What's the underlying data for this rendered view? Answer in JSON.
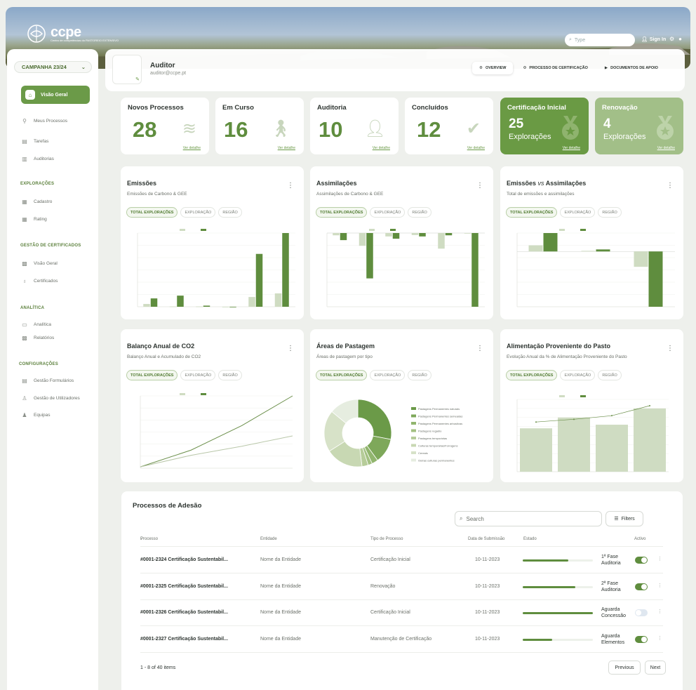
{
  "brand": {
    "name": "ccpe",
    "subtitle": "Centro de competências do PASTOREIO EXTENSIVO"
  },
  "topbar": {
    "search_placeholder": "Type",
    "signin": "Sign In"
  },
  "sidebar": {
    "campaign": "CAMPANHA 23/24",
    "active": "Visão Geral",
    "items_top": [
      "Meus Processos",
      "Tarefas",
      "Auditorias"
    ],
    "sections": [
      {
        "title": "EXPLORAÇÕES",
        "items": [
          "Cadastro",
          "Rating"
        ]
      },
      {
        "title": "GESTÃO DE CERTIFICADOS",
        "items": [
          "Visão Geral",
          "Certificados"
        ]
      },
      {
        "title": "ANALÍTICA",
        "items": [
          "Analítica",
          "Relatórios"
        ]
      },
      {
        "title": "CONFIGURAÇÕES",
        "items": [
          "Gestão Formulários",
          "Gestão de Utilizadores",
          "Equipas"
        ]
      }
    ]
  },
  "profile": {
    "name": "Auditor",
    "email": "auditor@ccpe.pt",
    "tabs": [
      "OVERVIEW",
      "PROCESSO DE CERTIFICAÇÃO",
      "DOCUMENTOS DE APOIO"
    ]
  },
  "stats": [
    {
      "title": "Novos Processos",
      "value": "28",
      "link": "Ver detalhe",
      "icon": "layers-icon"
    },
    {
      "title": "Em Curso",
      "value": "16",
      "link": "Ver detalhe",
      "icon": "walking-icon"
    },
    {
      "title": "Auditoria",
      "value": "10",
      "link": "Ver detalhe",
      "icon": "user-check-icon"
    },
    {
      "title": "Concluídos",
      "value": "12",
      "link": "Ver detalhe",
      "icon": "check-circle-icon"
    },
    {
      "title": "Certificação Inicial",
      "value": "25",
      "sub": "Explorações",
      "link": "Ver detalhe",
      "icon": "medal-icon"
    },
    {
      "title": "Renovação",
      "value": "4",
      "sub": "Explorações",
      "link": "Ver detalhe",
      "icon": "medal-icon"
    }
  ],
  "chips": [
    "TOTAL EXPLORAÇÕES",
    "EXPLORAÇÃO",
    "REGIÃO"
  ],
  "cards": [
    {
      "title": "Emissões",
      "subtitle": "Emissões de Carbono & GEE"
    },
    {
      "title": "Assimilações",
      "subtitle": "Assimilações de Carbono & GEE"
    },
    {
      "title_a": "Emissões ",
      "title_b": "vs",
      "title_c": " Assimilações",
      "subtitle": "Total de emissões e assimilações"
    },
    {
      "title": "Balanço Anual de CO2",
      "subtitle": "Balanço Anual e Acumulado de CO2"
    },
    {
      "title": "Áreas de Pastagem",
      "subtitle": "Áreas de pastagem por tipo"
    },
    {
      "title": "Alimentação Proveniente do Pasto",
      "subtitle": "Evolução Anual da % de Alimentação Proveniente do Pasto"
    }
  ],
  "chart_data": [
    {
      "type": "bar",
      "series": [
        {
          "values": [
            10,
            1,
            1,
            0,
            35,
            48
          ]
        },
        {
          "values": [
            30,
            40,
            4,
            0,
            190,
            265
          ]
        }
      ]
    },
    {
      "type": "bar",
      "series": [
        {
          "values": [
            -8,
            -45,
            -12,
            -7,
            -55,
            0
          ]
        },
        {
          "values": [
            -25,
            -160,
            -20,
            -12,
            -8,
            -260
          ]
        }
      ]
    },
    {
      "type": "bar",
      "series": [
        {
          "values": [
            30,
            3,
            -75
          ]
        },
        {
          "values": [
            90,
            10,
            -270
          ]
        }
      ]
    },
    {
      "type": "line",
      "series": [
        {
          "values": [
            5,
            70,
            165,
            280
          ]
        },
        {
          "values": [
            5,
            50,
            85,
            125
          ]
        }
      ]
    },
    {
      "type": "pie",
      "legend": [
        "Pastagens Permanentes naturais",
        "Pastagens Permanentes semeadas",
        "Pastagens Permanentes arbustivas",
        "Pastagens regadio",
        "Pastagens temporárias",
        "Culturas temporárias/Forragens",
        "Cereais",
        "Outras culturas permanentes"
      ],
      "values": [
        28,
        12,
        3,
        2,
        3,
        18,
        20,
        14
      ]
    },
    {
      "type": "bar",
      "series": [
        {
          "values": [
            48,
            60,
            52,
            70
          ]
        },
        {
          "values": [
            55,
            58,
            62,
            73
          ]
        }
      ]
    }
  ],
  "table": {
    "title": "Processos de Adesão",
    "search_placeholder": "Search",
    "filters": "Filters",
    "headers": [
      "Processo",
      "Entidade",
      "Tipo de Processo",
      "Data de Submissão",
      "Estado",
      "Activo"
    ],
    "rows": [
      {
        "processo": "#0001-2324 Certificação Sustentabil...",
        "entidade": "Nome da Entidade",
        "tipo": "Certificação Inicial",
        "data": "10-11-2023",
        "progress": 0.65,
        "estado": "1ª Fase Auditoria",
        "ativo": true
      },
      {
        "processo": "#0001-2325 Certificação Sustentabil...",
        "entidade": "Nome da Entidade",
        "tipo": "Renovação",
        "data": "10-11-2023",
        "progress": 0.75,
        "estado": "2ª Fase Auditoria",
        "ativo": true
      },
      {
        "processo": "#0001-2326 Certificação Sustentabil...",
        "entidade": "Nome da Entidade",
        "tipo": "Certificação Inicial",
        "data": "10-11-2023",
        "progress": 1.0,
        "estado": "Aguarda Concessão",
        "ativo": false
      },
      {
        "processo": "#0001-2327 Certificação Sustentabil...",
        "entidade": "Nome da Entidade",
        "tipo": "Manutenção de Certificação",
        "data": "10-11-2023",
        "progress": 0.42,
        "estado": "Aguarda Elementos",
        "ativo": true
      }
    ],
    "pager_info": "1 - 8 of 40 items",
    "previous": "Previous",
    "next": "Next"
  },
  "colors": {
    "primary": "#5f8d3e",
    "primary_light": "#a2bf88",
    "bar_light": "#cfdcc2"
  }
}
